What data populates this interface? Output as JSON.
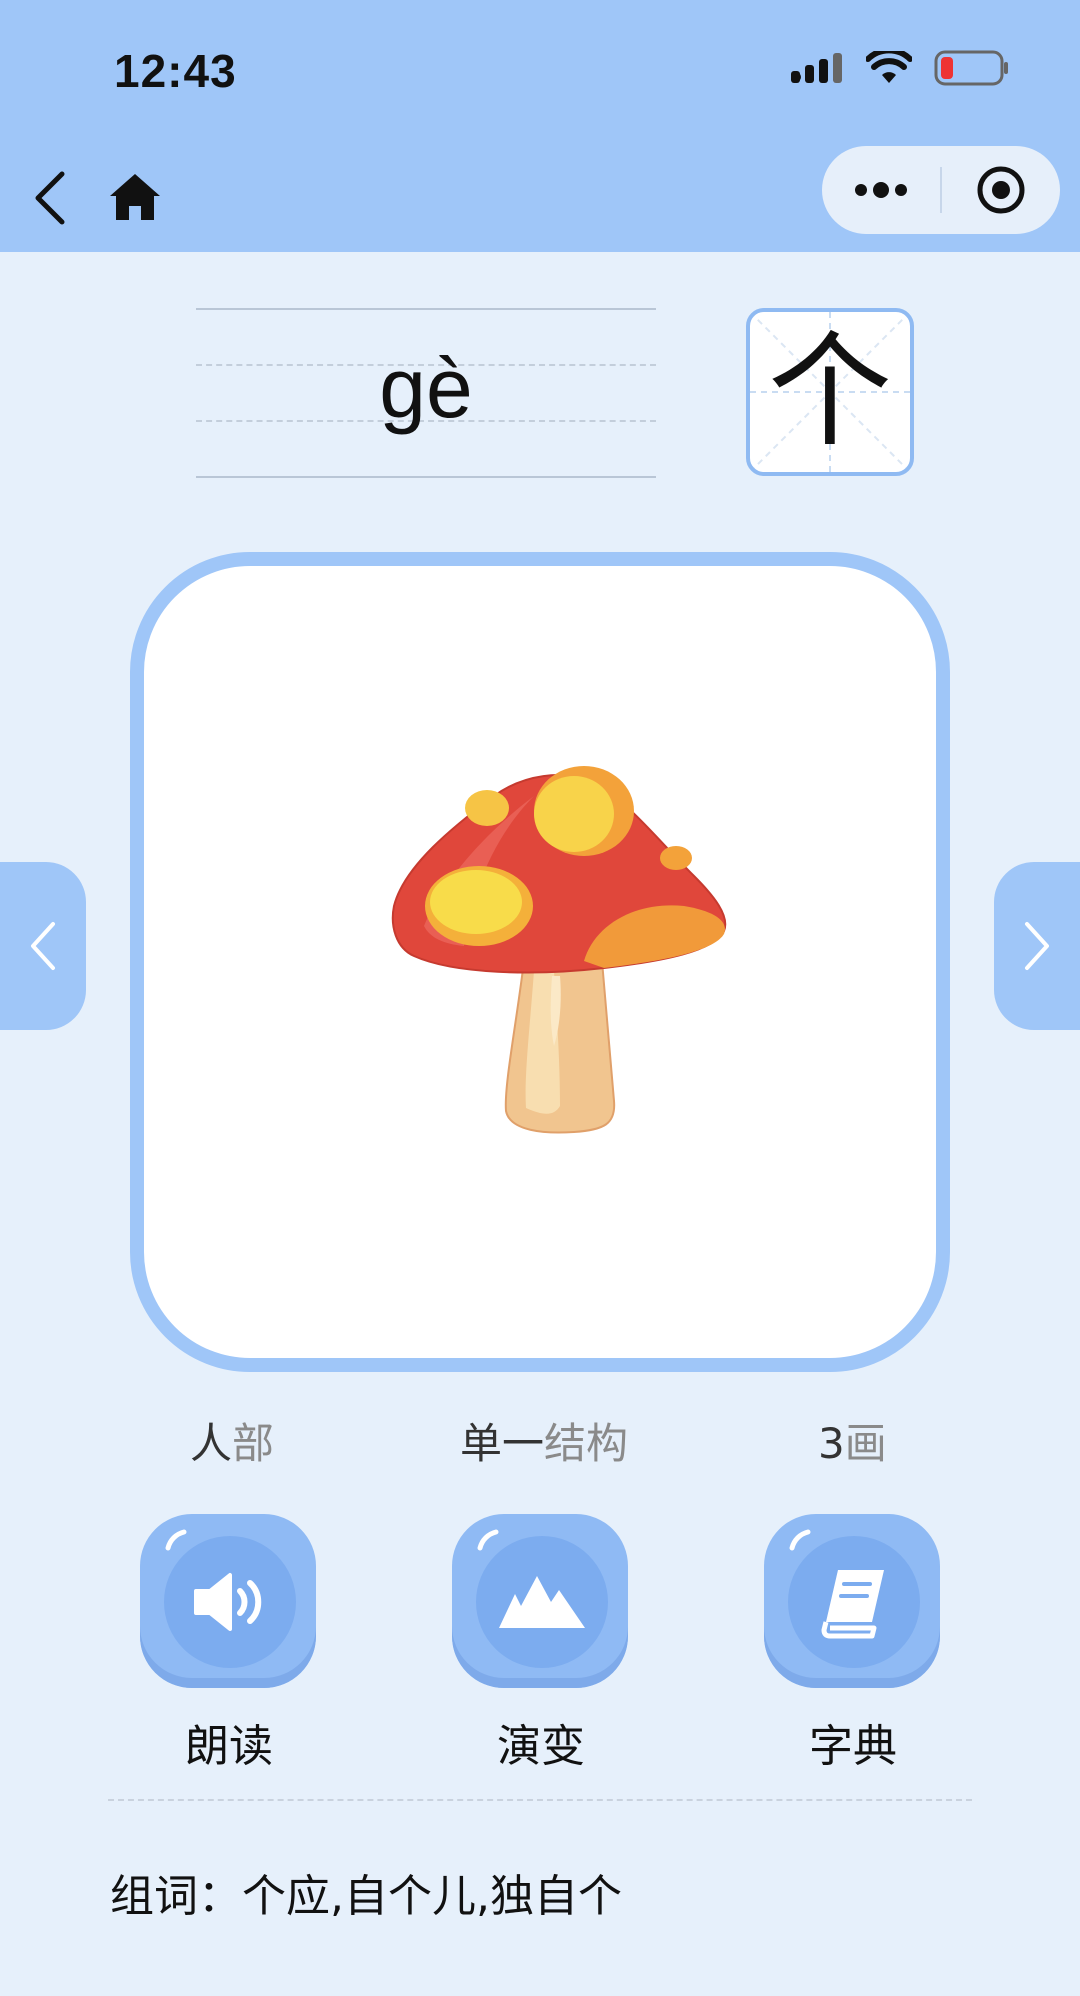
{
  "status_bar": {
    "time": "12:43"
  },
  "nav": {
    "back_icon": "chevron-left-icon",
    "home_icon": "home-icon",
    "menu_icon": "more-dots-icon",
    "close_icon": "target-circle-icon"
  },
  "pinyin": "gè",
  "character": "个",
  "image": {
    "subject": "mushroom-illustration"
  },
  "info": {
    "radical": "人",
    "radical_suffix": "部",
    "structure": "单一",
    "structure_suffix": "结构",
    "strokes": "3",
    "strokes_suffix": "画"
  },
  "features": [
    {
      "label": "朗读",
      "icon": "speaker-icon"
    },
    {
      "label": "演变",
      "icon": "mountain-icon"
    },
    {
      "label": "字典",
      "icon": "book-icon"
    }
  ],
  "words": {
    "prefix": "组词：",
    "list": "个应,自个儿,独自个"
  },
  "colors": {
    "accent": "#9fc6f8",
    "background": "#e6f0fb",
    "button": "#8fbaf4"
  }
}
